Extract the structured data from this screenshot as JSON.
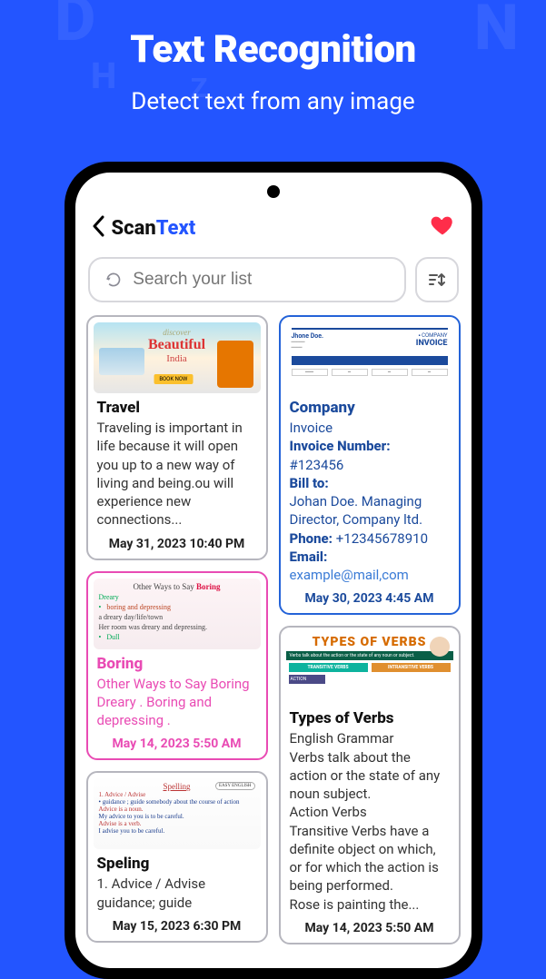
{
  "hero": {
    "title": "Text Recognition",
    "subtitle": "Detect text from any image"
  },
  "header": {
    "title_a": "Scan ",
    "title_b": "Text"
  },
  "search": {
    "placeholder": "Search your list"
  },
  "cards": {
    "travel": {
      "title": "Travel",
      "body": "Traveling is important in life because it will open you up to a new way of living and being.ou will experience new connections...",
      "date": "May 31, 2023 10:40 PM"
    },
    "boring": {
      "title": "Boring",
      "body": "Other Ways to Say Boring Dreary . Boring and depressing .",
      "date": "May 14, 2023 5:50 AM"
    },
    "speling": {
      "title": "Speling",
      "body": " 1. Advice / Advise guidance; guide",
      "date": "May 15, 2023 6:30 PM"
    },
    "company": {
      "title": "Company",
      "line1": "Invoice",
      "key1": "Invoice Number:",
      "val1": "#123456",
      "key2": "Bill to:",
      "line2": "Johan Doe. Managing Director, Company ltd.",
      "key3": "Phone: ",
      "val3": "+12345678910",
      "key4": "Email:",
      "email": "example@mail,com",
      "date": "May 30, 2023 4:45 AM"
    },
    "verbs": {
      "title": "Types of Verbs",
      "body": "English Grammar\nVerbs talk about the action or the state of any noun subject.\nAction Verbs\nTransitive Verbs have a definite object on which, or for which the action is being performed.\nRose is painting the...",
      "date": "May 14, 2023 5:50 AM"
    }
  },
  "thumbs": {
    "travel": {
      "discover": "discover",
      "beautiful": "Beautiful",
      "india": "India",
      "btn": "BOOK NOW"
    },
    "invoice": {
      "name": "Jhone Doe.",
      "company": "COMPANY",
      "invoice": "INVOICE"
    },
    "boring": {
      "title_a": "Other Ways to Say ",
      "title_b": "Boring",
      "l1a": "Dreary",
      "l1b": "boring and depressing",
      "l2": "a dreary day/life/town",
      "l3": "Her room was dreary and depressing.",
      "l4": "Dull"
    },
    "verbs": {
      "title": "TYPES OF VERBS",
      "sub": "Verbs talk about the action or the state of any noun or subject.",
      "t1": "TRANSITIVE VERBS",
      "t2": "INTRANSITIVE VERBS",
      "act": "ACTION"
    },
    "spell": {
      "title": "Spelling",
      "badge": "EASY ENGLISH",
      "l1": "1. Advice / Advise",
      "l2": "• guidance ; guide somebody about the course of action",
      "l3": "Advice is a noun.",
      "l4": "My advice to you is to be careful.",
      "l5": "Advise is a verb.",
      "l6": "I advise you to be careful."
    }
  }
}
